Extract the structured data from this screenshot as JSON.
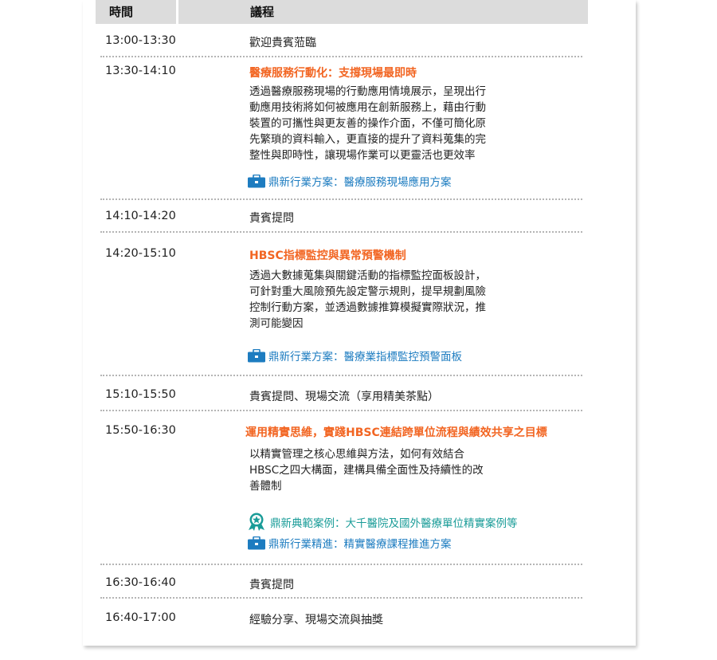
{
  "header": {
    "time": "時間",
    "agenda": "議程"
  },
  "rows": [
    {
      "time": "13:00-13:30",
      "agenda": "歡迎貴賓蒞臨"
    },
    {
      "time": "13:30-14:10",
      "title": "醫療服務行動化：支撐現場最即時",
      "desc": [
        "透過醫療服務現場的行動應用情境展示，呈現出行",
        "動應用技術將如何被應用在創新服務上，藉由行動",
        "裝置的可攜性與更友善的操作介面，不僅可簡化原",
        "先繁瑣的資料輸入，更直接的提升了資料蒐集的完",
        "整性與即時性，讓現場作業可以更靈活也更效率"
      ],
      "links": [
        {
          "icon": "briefcase-icon",
          "text": "鼎新行業方案：醫療服務現場應用方案"
        }
      ]
    },
    {
      "time": "14:10-14:20",
      "agenda": "貴賓提問"
    },
    {
      "time": "14:20-15:10",
      "title": "HBSC指標監控與異常預警機制",
      "desc": [
        "透過大數據蒐集與關鍵活動的指標監控面板設計，",
        "可針對重大風險預先設定警示規則，提早規劃風險",
        "控制行動方案，並透過數據推算模擬實際狀況，推",
        "測可能變因"
      ],
      "links": [
        {
          "icon": "briefcase-icon",
          "text": "鼎新行業方案：醫療業指標監控預警面板"
        }
      ]
    },
    {
      "time": "15:10-15:50",
      "agenda": "貴賓提問、現場交流（享用精美茶點）"
    },
    {
      "time": "15:50-16:30",
      "title": "運用精實思維，實踐HBSC連結跨單位流程與績效共享之目標",
      "desc": [
        "以精實管理之核心思維與方法，如何有效結合",
        "HBSC之四大構面，建構具備全面性及持續性的改",
        "善體制"
      ],
      "links": [
        {
          "icon": "award-icon",
          "text": "鼎新典範案例：大千醫院及國外醫療單位精實案例等"
        },
        {
          "icon": "briefcase-icon",
          "text": "鼎新行業精進：精實醫療課程推進方案"
        }
      ]
    },
    {
      "time": "16:30-16:40",
      "agenda": "貴賓提問"
    },
    {
      "time": "16:40-17:00",
      "agenda": "經驗分享、現場交流與抽獎"
    }
  ],
  "colors": {
    "title": "#f26522",
    "link": "#1d7cc0",
    "award": "#1a9c98",
    "header_bg": "#dcdcdc"
  }
}
